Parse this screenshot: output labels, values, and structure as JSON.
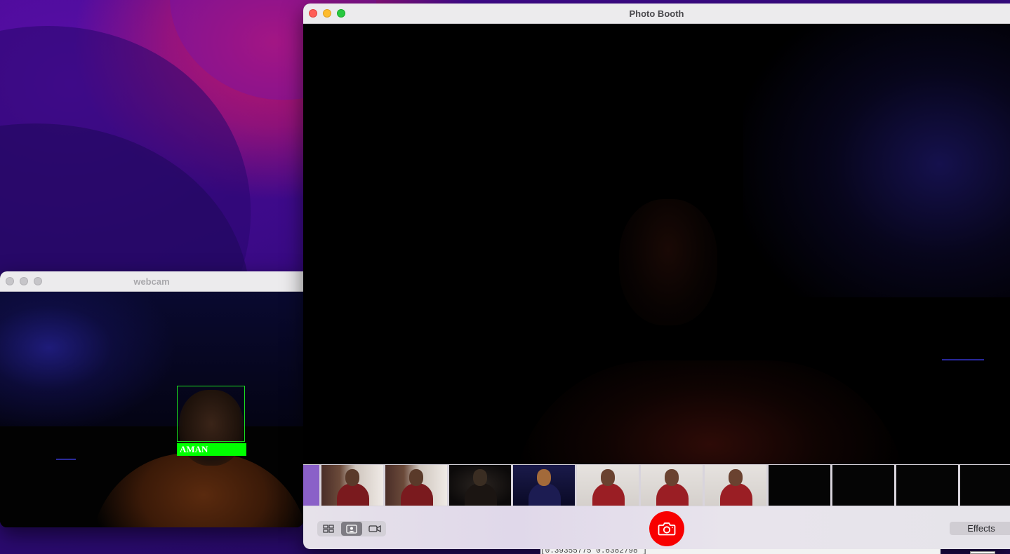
{
  "desktop": {
    "background_colors": [
      "#4b0a9c",
      "#c0176b",
      "#2a0a6e"
    ]
  },
  "webcam_window": {
    "title": "webcam",
    "face_label": "AMAN",
    "box_color": "#00ff00"
  },
  "photobooth_window": {
    "title": "Photo Booth",
    "toolbar": {
      "view_buttons": [
        "grid-view-icon",
        "photo-view-icon",
        "video-view-icon"
      ],
      "active_view": "photo-view-icon",
      "shutter_icon": "camera-icon",
      "shutter_color": "#f80000",
      "effects_label": "Effects"
    },
    "filmstrip": {
      "thumbnail_count": 12
    }
  },
  "terminal_sliver": {
    "text": "[0.39355775 0.6382798 ]"
  }
}
